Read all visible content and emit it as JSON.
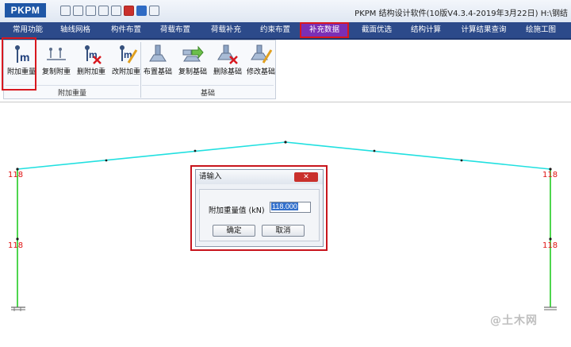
{
  "app": {
    "logo_text": "PKPM",
    "window_title": "PKPM 结构设计软件(10版V4.3.4-2019年3月22日) H:\\钢结"
  },
  "quick_access": [
    "save-icon",
    "save-as-icon",
    "print-icon",
    "open-icon",
    "folder-icon",
    "toolbox-icon",
    "help-icon",
    "document-icon"
  ],
  "tabs": [
    {
      "label": "常用功能"
    },
    {
      "label": "轴线网格"
    },
    {
      "label": "构件布置"
    },
    {
      "label": "荷载布置"
    },
    {
      "label": "荷载补充"
    },
    {
      "label": "约束布置"
    },
    {
      "label": "补充数据"
    },
    {
      "label": "截面优选"
    },
    {
      "label": "结构计算"
    },
    {
      "label": "计算结果查询"
    },
    {
      "label": "绘施工图"
    }
  ],
  "active_tab": "补充数据",
  "ribbon": {
    "groups": [
      {
        "name": "附加重量",
        "buttons": [
          {
            "label": "附加重量"
          },
          {
            "label": "复制附重"
          },
          {
            "label": "删附加重"
          },
          {
            "label": "改附加重"
          }
        ]
      },
      {
        "name": "基础",
        "buttons": [
          {
            "label": "布置基础"
          },
          {
            "label": "复制基础"
          },
          {
            "label": "删除基础"
          },
          {
            "label": "修改基础"
          }
        ]
      }
    ]
  },
  "canvas": {
    "labels": [
      "118",
      "118",
      "118",
      "118"
    ]
  },
  "dialog": {
    "title": "请输入",
    "close_label": "✕",
    "field_label": "附加重量值 (kN)",
    "field_value": "118.000",
    "ok_label": "确定",
    "cancel_label": "取消"
  },
  "watermark": "@土木网",
  "colors": {
    "tab_bar": "#2c4a8a",
    "active_tab": "#7b2fb5",
    "highlight": "#d8181f",
    "beam": "#21e0e0",
    "column": "#22cc22",
    "load_label": "#e01010"
  }
}
